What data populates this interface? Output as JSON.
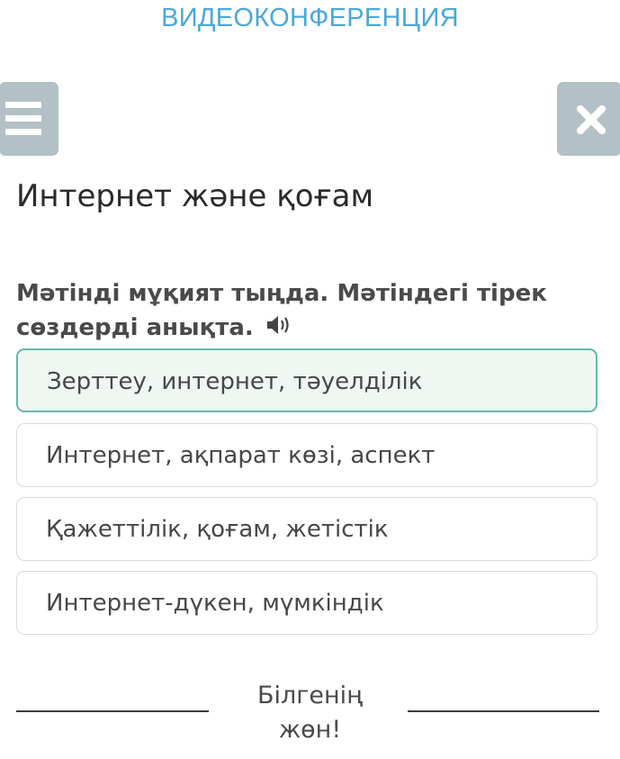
{
  "header": {
    "title": "ВИДЕОКОНФЕРЕНЦИЯ"
  },
  "toolbar": {
    "menu_icon": "menu-icon",
    "close_icon": "close-icon"
  },
  "lesson": {
    "title": "Интернет және қоғам"
  },
  "question": {
    "text": "Мәтінді мұқият тыңда. Мәтіндегі тірек сөздерді анықта.",
    "audio_icon": "speaker-icon"
  },
  "options": [
    {
      "label": "Зерттеу, интернет, тәуелділік",
      "selected": true
    },
    {
      "label": "Интернет, ақпарат көзі, аспект",
      "selected": false
    },
    {
      "label": "Қажеттілік, қоғам, жетістік",
      "selected": false
    },
    {
      "label": "Интернет-дүкен, мүмкіндік",
      "selected": false
    }
  ],
  "feedback": {
    "line1": "Білгенің",
    "line2": "жөн!"
  },
  "colors": {
    "header_text": "#4aa8d8",
    "icon_button_bg": "#b3c0c6",
    "selected_border": "#66b8aa",
    "selected_bg": "#eef7f2"
  }
}
